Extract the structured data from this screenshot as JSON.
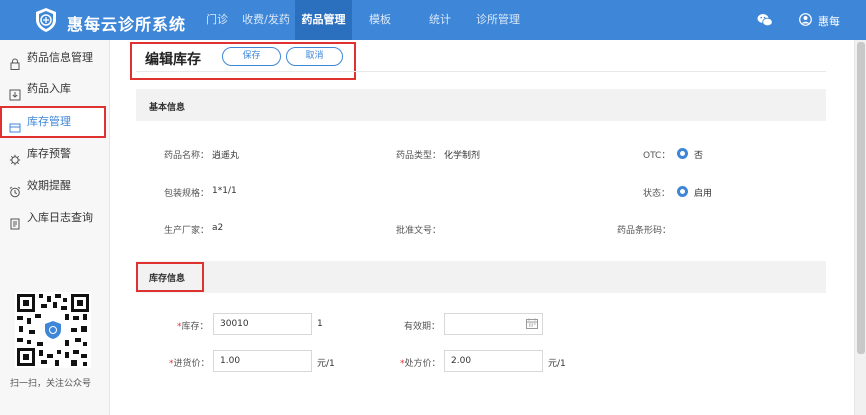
{
  "app": {
    "title": "惠每云诊所系统"
  },
  "nav": {
    "items": [
      {
        "label": "门诊"
      },
      {
        "label": "收费/发药"
      },
      {
        "label": "药品管理"
      },
      {
        "label": "模板"
      },
      {
        "label": "统计"
      },
      {
        "label": "诊所管理"
      }
    ],
    "active": "药品管理"
  },
  "user": {
    "name": "惠每"
  },
  "sidebar": {
    "items": [
      {
        "label": "药品信息管理",
        "icon": "lock-icon"
      },
      {
        "label": "药品入库",
        "icon": "import-icon"
      },
      {
        "label": "库存管理",
        "icon": "inventory-icon"
      },
      {
        "label": "库存预警",
        "icon": "warning-gear-icon"
      },
      {
        "label": "效期提醒",
        "icon": "alarm-clock-icon"
      },
      {
        "label": "入库日志查询",
        "icon": "log-icon"
      }
    ],
    "active": "库存管理",
    "qr_caption": "扫一扫，关注公众号"
  },
  "page": {
    "title": "编辑库存",
    "save_label": "保存",
    "cancel_label": "取消"
  },
  "basic_info": {
    "section_title": "基本信息",
    "drug_name_label": "药品名称：",
    "drug_name": "逍遥丸",
    "drug_type_label": "药品类型：",
    "drug_type": "化学制剂",
    "otc_label": "OTC：",
    "otc_value": "否",
    "spec_label": "包装规格：",
    "spec": "1*1/1",
    "status_label": "状态：",
    "status_value": "启用",
    "manufacturer_label": "生产厂家：",
    "manufacturer": "a2",
    "approval_label": "批准文号：",
    "approval": "",
    "barcode_label": "药品条形码：",
    "barcode": ""
  },
  "stock_info": {
    "section_title": "库存信息",
    "stock_label": "库存：",
    "stock_value": "30010",
    "stock_unit": "1",
    "expiry_label": "有效期：",
    "expiry_value": "",
    "purchase_price_label": "进货价：",
    "purchase_price": "1.00",
    "purchase_unit": "元/1",
    "retail_price_label": "处方价：",
    "retail_price": "2.00",
    "retail_unit": "元/1",
    "required_mark": "*"
  },
  "colors": {
    "primary": "#3d86d8",
    "highlight": "#e03131"
  }
}
